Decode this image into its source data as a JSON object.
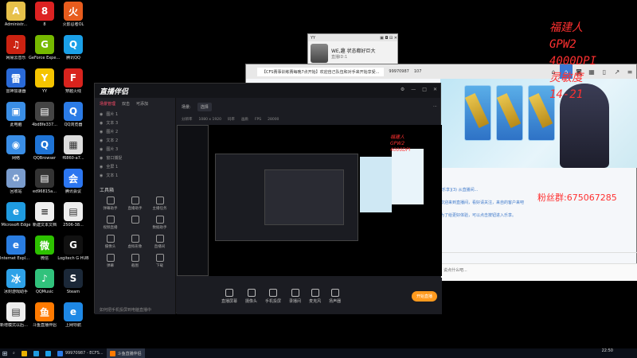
{
  "desktop_icons": [
    {
      "label": "Administr...",
      "color": "#e7c14a",
      "glyph": "A"
    },
    {
      "label": "8",
      "color": "#d22",
      "glyph": "8"
    },
    {
      "label": "火影忍者OL",
      "color": "#e85c1d",
      "glyph": "火"
    },
    {
      "label": "网易云音乐",
      "color": "#c21",
      "glyph": "♫"
    },
    {
      "label": "GeForce Experience",
      "color": "#76b900",
      "glyph": "G"
    },
    {
      "label": "腾讯QQ",
      "color": "#1aa0e8",
      "glyph": "Q"
    },
    {
      "label": "雷神加速器",
      "color": "#2a6ad8",
      "glyph": "雷"
    },
    {
      "label": "YY",
      "color": "#f5c400",
      "glyph": "Y"
    },
    {
      "label": "穿越火线",
      "color": "#d8231d",
      "glyph": "F"
    },
    {
      "label": "此电脑",
      "color": "#3a8ee6",
      "glyph": "▣"
    },
    {
      "label": "4bd8fe337...",
      "color": "#444",
      "glyph": "▤"
    },
    {
      "label": "QQ浏览器",
      "color": "#2b7be6",
      "glyph": "Q"
    },
    {
      "label": "网络",
      "color": "#3a8ee6",
      "glyph": "◉"
    },
    {
      "label": "QQBrowser",
      "color": "#1f74d6",
      "glyph": "Q"
    },
    {
      "label": "f6860-a7...",
      "color": "#ddd",
      "glyph": "▦"
    },
    {
      "label": "回收站",
      "color": "#7a9ccd",
      "glyph": "♻"
    },
    {
      "label": "ed96815a...",
      "color": "#333",
      "glyph": "▤"
    },
    {
      "label": "腾讯会议",
      "color": "#2c76f0",
      "glyph": "会"
    },
    {
      "label": "Microsoft Edge",
      "color": "#1f9be0",
      "glyph": "e"
    },
    {
      "label": "新建文本文档",
      "color": "#eee",
      "glyph": "≡"
    },
    {
      "label": "2506-38...",
      "color": "#eee",
      "glyph": "▤"
    },
    {
      "label": "Internet Explorer",
      "color": "#2a7de1",
      "glyph": "e"
    },
    {
      "label": "微信",
      "color": "#2dc100",
      "glyph": "微"
    },
    {
      "label": "Logitech G HUB",
      "color": "#111",
      "glyph": "G"
    },
    {
      "label": "冰封游戏助手",
      "color": "#2ea2e8",
      "glyph": "冰"
    },
    {
      "label": "QQMusic",
      "color": "#31c27c",
      "glyph": "♪"
    },
    {
      "label": "Steam",
      "color": "#1b2838",
      "glyph": "S"
    },
    {
      "label": "新增模式以后更稳定",
      "color": "#eee",
      "glyph": "▤"
    },
    {
      "label": "斗鱼直播伴侣",
      "color": "#ff7a00",
      "glyph": "鱼"
    },
    {
      "label": "上网导航",
      "color": "#1e88e5",
      "glyph": "e"
    }
  ],
  "overlay": {
    "lines": [
      "福建人",
      "GPW2",
      "4000DPI",
      "灵敏度",
      "14-21"
    ],
    "fans": "粉丝群:675067285"
  },
  "popup": {
    "title": "YY",
    "text": "WE,趣  状态都好巨大",
    "sub": "直播ID:1"
  },
  "browser": {
    "tab_title": "【CFS赛事训练赛每晚7点开始】欢迎自己队伍和对手来开始享受...",
    "room_id": "99970987",
    "count": "107",
    "chat_lines": [
      "[乐享](3) 从直播间...",
      "欢迎来到直播间，看好请关注，来自的客户来吧",
      "为了给更好体验，可以点击按钮进入乐享。"
    ],
    "input_placeholder": "说点什么吧..."
  },
  "app": {
    "title": "直播伴侣",
    "left_tabs": [
      "场景管理",
      "双击",
      "可添加"
    ],
    "sources": [
      "图片 1",
      "文本 3",
      "图片 2",
      "文本 2",
      "图片 3",
      "窗口捕捉",
      "全屏 1",
      "文本 1"
    ],
    "tools_title": "工具箱",
    "tools": [
      "弹幕助手",
      "直播助手",
      "主播任务",
      "视频直播",
      "",
      "数据助手",
      "摄像头",
      "虚拟形象",
      "直播间",
      "弹幕",
      "截图",
      "下载"
    ],
    "tip": "如何把手机投屏到电脑直播中",
    "toolbar": [
      "场景:",
      "选择",
      "分辨率",
      "1080 x 1920",
      "码率",
      "画质",
      "FPS",
      "28000"
    ],
    "bottom": [
      "直播屏幕",
      "摄像头",
      "手机投屏",
      "录播间",
      "麦克风",
      "扬声器"
    ],
    "start_label": "开始直播"
  },
  "taskbar": {
    "items": [
      "99970987 - ECFS...",
      "斗鱼直播伴侣"
    ],
    "time": "22:50",
    "date": ""
  }
}
